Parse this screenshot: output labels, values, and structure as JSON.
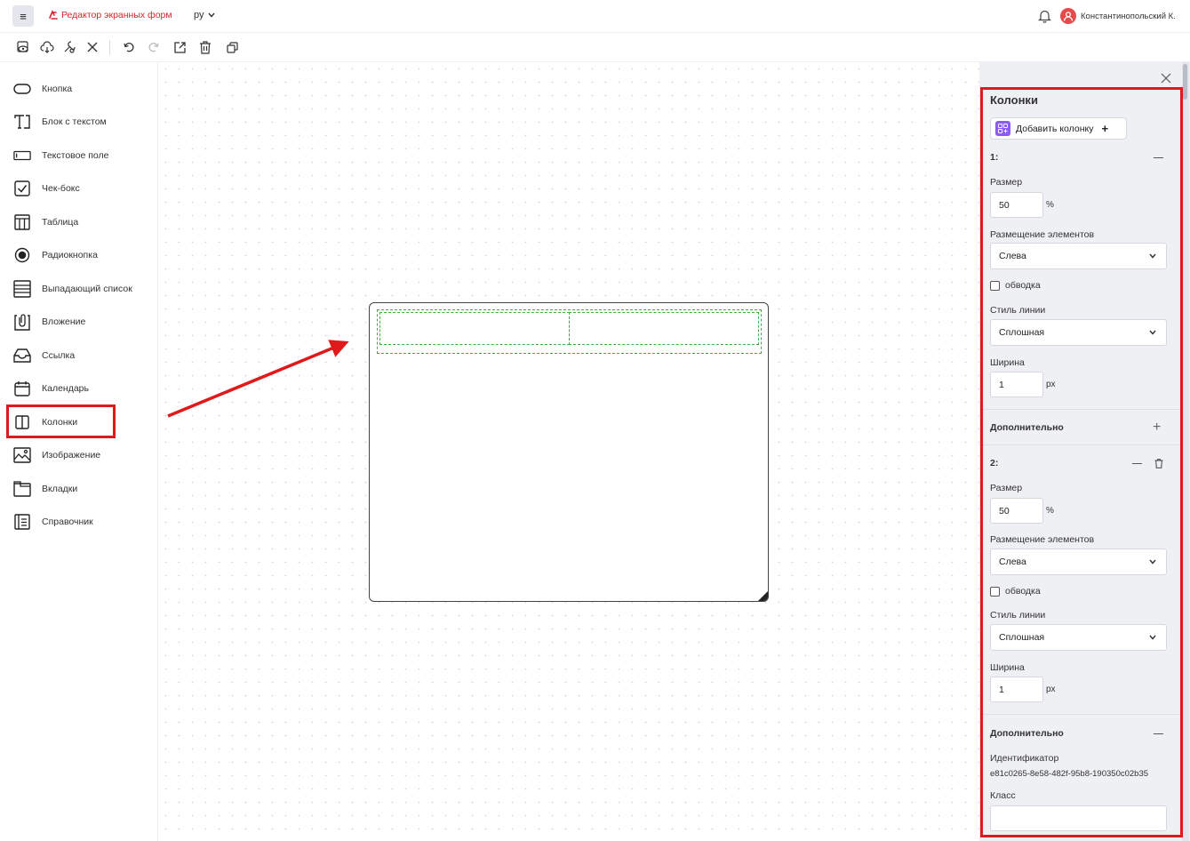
{
  "header": {
    "app_title": "Редактор экранных форм",
    "language": "ру",
    "user_name": "Константинопольский К."
  },
  "toolbar": {
    "icons": [
      "preview-icon",
      "cloud-save-icon",
      "settings-tools-icon",
      "close-icon",
      "undo-icon",
      "redo-icon",
      "export-icon",
      "trash-icon",
      "copy-icon"
    ]
  },
  "palette": {
    "items": [
      {
        "label": "Кнопка",
        "icon": "button-icon"
      },
      {
        "label": "Блок с текстом",
        "icon": "text-block-icon"
      },
      {
        "label": "Текстовое поле",
        "icon": "text-field-icon"
      },
      {
        "label": "Чек-бокс",
        "icon": "checkbox-icon"
      },
      {
        "label": "Таблица",
        "icon": "table-icon"
      },
      {
        "label": "Радиокнопка",
        "icon": "radio-icon"
      },
      {
        "label": "Выпадающий список",
        "icon": "dropdown-icon"
      },
      {
        "label": "Вложение",
        "icon": "attachment-icon"
      },
      {
        "label": "Ссылка",
        "icon": "link-icon"
      },
      {
        "label": "Календарь",
        "icon": "calendar-icon"
      },
      {
        "label": "Колонки",
        "icon": "columns-icon"
      },
      {
        "label": "Изображение",
        "icon": "image-icon"
      },
      {
        "label": "Вкладки",
        "icon": "tabs-icon"
      },
      {
        "label": "Справочник",
        "icon": "directory-icon"
      }
    ],
    "selected": "Колонки"
  },
  "colors": {
    "brand_red": "#d2252c",
    "highlight_red": "#e01a1a",
    "accent_purple": "#8a5cf5",
    "dashed_green": "#3fae3f"
  },
  "panel": {
    "title": "Колонки",
    "add_column_label": "Добавить колонку",
    "add_column_plus": "+",
    "columns": [
      {
        "header": "1:",
        "size_label": "Размер",
        "size_value": "50",
        "size_unit": "%",
        "placement_label": "Размещение элементов",
        "placement_value": "Слева",
        "border_label": "обводка",
        "border_checked": false,
        "line_style_label": "Стиль линии",
        "line_style_value": "Сплошная",
        "width_label": "Ширина",
        "width_value": "1",
        "width_unit": "px",
        "extra_label": "Дополнительно"
      },
      {
        "header": "2:",
        "size_label": "Размер",
        "size_value": "50",
        "size_unit": "%",
        "placement_label": "Размещение элементов",
        "placement_value": "Слева",
        "border_label": "обводка",
        "border_checked": false,
        "line_style_label": "Стиль линии",
        "line_style_value": "Сплошная",
        "width_label": "Ширина",
        "width_value": "1",
        "width_unit": "px",
        "extra_label": "Дополнительно",
        "identifier_label": "Идентификатор",
        "identifier_value": "e81c0265-8e58-482f-95b8-190350c02b35",
        "class_label": "Класс",
        "class_value": ""
      }
    ]
  }
}
